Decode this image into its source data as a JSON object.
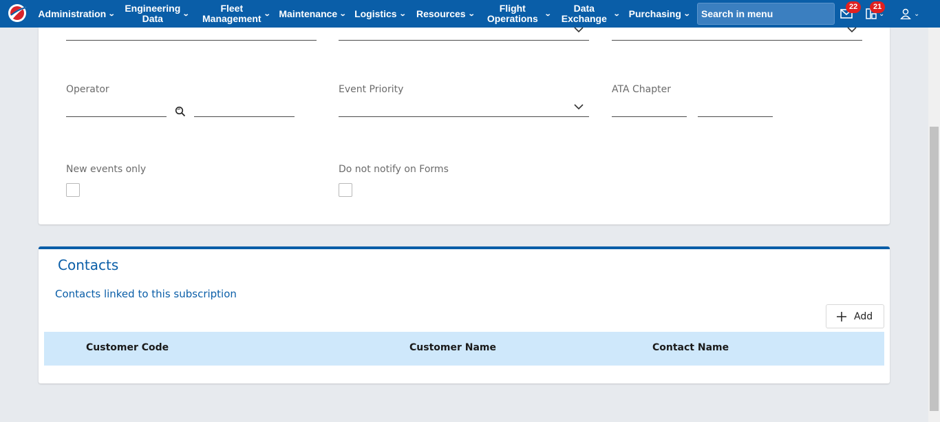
{
  "nav": {
    "items": [
      {
        "label": "Administration"
      },
      {
        "label": "Engineering\nData"
      },
      {
        "label": "Fleet\nManagement"
      },
      {
        "label": "Maintenance"
      },
      {
        "label": "Logistics"
      },
      {
        "label": "Resources"
      },
      {
        "label": "Flight\nOperations"
      },
      {
        "label": "Data\nExchange"
      },
      {
        "label": "Purchasing"
      }
    ],
    "search_placeholder": "Search in menu",
    "mail_badge": "22",
    "tasks_badge": "21",
    "brand_color": "#0a5ea8",
    "badge_color": "#e02020"
  },
  "form": {
    "operator_label": "Operator",
    "event_priority_label": "Event Priority",
    "ata_chapter_label": "ATA Chapter",
    "new_events_only_label": "New events only",
    "do_not_notify_label": "Do not notify on Forms",
    "new_events_only_checked": false,
    "do_not_notify_checked": false
  },
  "contacts": {
    "title": "Contacts",
    "subtitle": "Contacts linked to this subscription",
    "add_label": "Add",
    "columns": [
      "Customer Code",
      "Customer Name",
      "Contact Name"
    ],
    "header_color": "#cfe8fb"
  }
}
